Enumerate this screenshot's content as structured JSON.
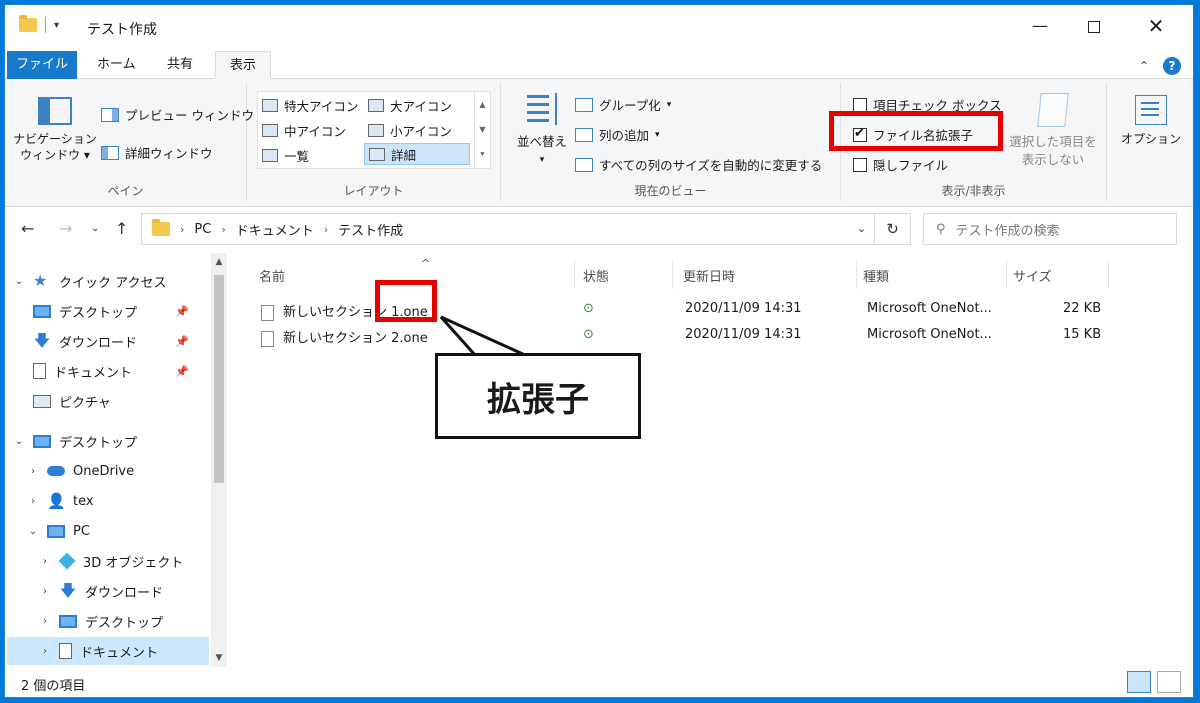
{
  "window": {
    "title": "テスト作成",
    "controls": {
      "minimize": "—",
      "close": "✕"
    }
  },
  "tabs": {
    "file": "ファイル",
    "home": "ホーム",
    "share": "共有",
    "view": "表示"
  },
  "ribbon": {
    "pane": {
      "nav_pane": "ナビゲーション",
      "nav_pane2": "ウィンドウ",
      "preview": "プレビュー ウィンドウ",
      "details": "詳細ウィンドウ",
      "label": "ペイン"
    },
    "layout": {
      "items": [
        "特大アイコン",
        "大アイコン",
        "中アイコン",
        "小アイコン",
        "一覧",
        "詳細"
      ],
      "label": "レイアウト"
    },
    "current_view": {
      "sort": "並べ替え",
      "group_by": "グループ化",
      "add_column": "列の追加",
      "size_all": "すべての列のサイズを自動的に変更する",
      "label": "現在のビュー"
    },
    "show_hide": {
      "item_checkbox": "項目チェック ボックス",
      "file_ext": "ファイル名拡張子",
      "hidden": "隠しファイル",
      "hide_selected1": "選択した項目を",
      "hide_selected2": "表示しない",
      "label": "表示/非表示"
    },
    "options": {
      "label": "オプション"
    }
  },
  "address": {
    "crumbs": [
      "PC",
      "ドキュメント",
      "テスト作成"
    ],
    "search_placeholder": "テスト作成の検索"
  },
  "tree": {
    "quick_access": "クイック アクセス",
    "qa_items": [
      "デスクトップ",
      "ダウンロード",
      "ドキュメント",
      "ピクチャ"
    ],
    "desktop": "デスクトップ",
    "onedrive": "OneDrive",
    "user": "tex",
    "pc": "PC",
    "pc_items": [
      "3D オブジェクト",
      "ダウンロード",
      "デスクトップ",
      "ドキュメント"
    ]
  },
  "columns": {
    "name": "名前",
    "status": "状態",
    "modified": "更新日時",
    "type": "種類",
    "size": "サイズ"
  },
  "files": [
    {
      "name": "新しいセクション 1.one",
      "modified": "2020/11/09 14:31",
      "type": "Microsoft OneNot...",
      "size": "22 KB"
    },
    {
      "name": "新しいセクション 2.one",
      "modified": "2020/11/09 14:31",
      "type": "Microsoft OneNot...",
      "size": "15 KB"
    }
  ],
  "annotation": {
    "callout": "拡張子"
  },
  "status": {
    "count": "2 個の項目"
  },
  "colors": {
    "accent": "#1979ca",
    "highlight_red": "#e60000",
    "selection": "#cce8ff"
  }
}
